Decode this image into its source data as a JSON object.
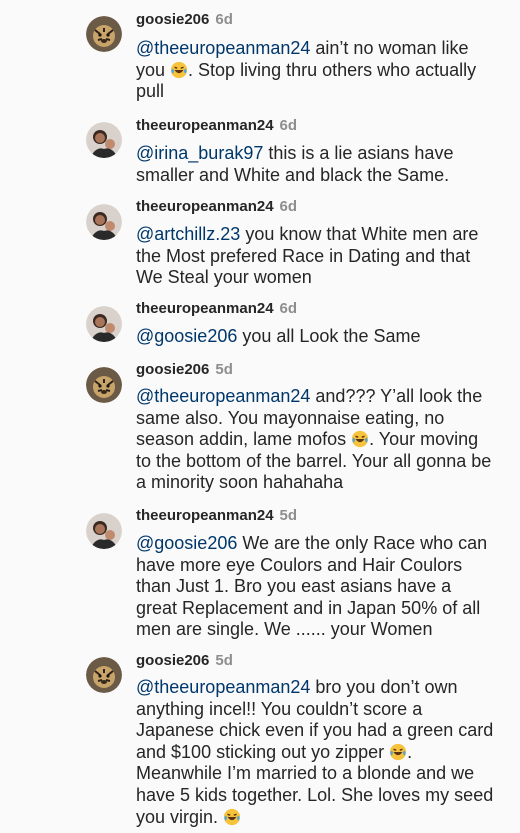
{
  "comments": [
    {
      "username": "goosie206",
      "age": "6d",
      "avatar": "tiger-avatar",
      "mention": "@theeuropeanman24",
      "text": " ain’t no woman like you ",
      "emoji": "laughing-tears",
      "text2": ". Stop living thru others who actually pull",
      "emoji2": "",
      "text3": ""
    },
    {
      "username": "theeuropeanman24",
      "age": "6d",
      "avatar": "person-avatar",
      "mention": "@irina_burak97",
      "text": " this is a lie asians have smaller and White and black the Same.",
      "emoji": "",
      "text2": "",
      "emoji2": "",
      "text3": ""
    },
    {
      "username": "theeuropeanman24",
      "age": "6d",
      "avatar": "person-avatar",
      "mention": "@artchillz.23",
      "text": " you know that White men are the Most prefered Race in Dating and that We Steal your women",
      "emoji": "",
      "text2": "",
      "emoji2": "",
      "text3": ""
    },
    {
      "username": "theeuropeanman24",
      "age": "6d",
      "avatar": "person-avatar",
      "mention": "@goosie206",
      "text": " you all Look the Same",
      "emoji": "",
      "text2": "",
      "emoji2": "",
      "text3": ""
    },
    {
      "username": "goosie206",
      "age": "5d",
      "avatar": "tiger-avatar",
      "mention": "@theeuropeanman24",
      "text": " and??? Y’all look the same also. You mayonnaise eating, no season addin, lame mofos ",
      "emoji": "laughing-tears",
      "text2": ". Your moving to the bottom of the barrel. Your all gonna be a minority soon hahahaha",
      "emoji2": "",
      "text3": ""
    },
    {
      "username": "theeuropeanman24",
      "age": "5d",
      "avatar": "person-avatar",
      "mention": "@goosie206",
      "text": " We are the only Race who can have more eye Coulors and Hair Coulors than Just 1. Bro you east asians have a great Replacement and in Japan 50% of all men are single. We ...... your Women",
      "emoji": "",
      "text2": "",
      "emoji2": "",
      "text3": ""
    },
    {
      "username": "goosie206",
      "age": "5d",
      "avatar": "tiger-avatar",
      "mention": "@theeuropeanman24",
      "text": " bro you don’t own anything incel!! You couldn’t score a Japanese chick even if you had a green card and $100 sticking out yo zipper ",
      "emoji": "laughing-tears",
      "text2": ". Meanwhile I’m married to a blonde and we have 5 kids together. Lol. She loves my seed you virgin. ",
      "emoji2": "laughing-tears",
      "text3": ""
    }
  ],
  "colors": {
    "background": "#fafafa",
    "text": "#262626",
    "muted": "#8e8e8e",
    "mention": "#00376b"
  }
}
